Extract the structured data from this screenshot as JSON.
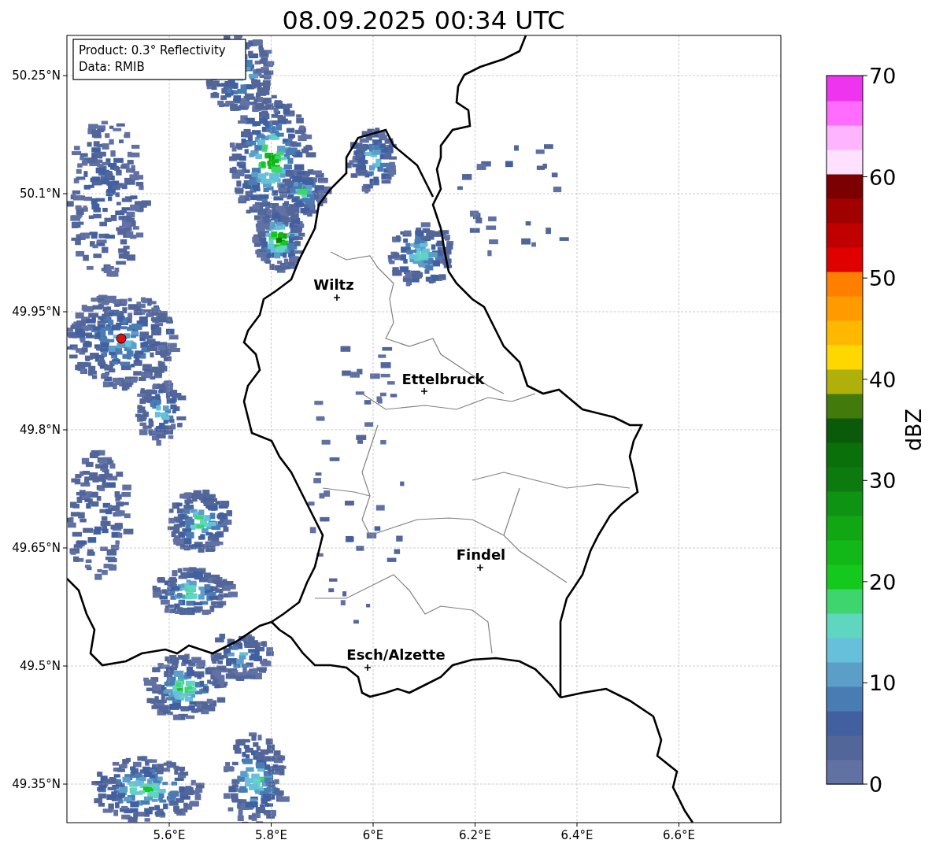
{
  "title": "08.09.2025 00:34 UTC",
  "info_box": {
    "lines": [
      "Product: 0.3° Reflectivity",
      "Data: RMIB"
    ]
  },
  "map": {
    "lat_ticks": [
      "50.25°N",
      "50.1°N",
      "49.95°N",
      "49.8°N",
      "49.65°N",
      "49.5°N",
      "49.35°N"
    ],
    "lon_ticks": [
      "5.6°E",
      "5.8°E",
      "6°E",
      "6.2°E",
      "6.4°E",
      "6.6°E"
    ],
    "cities": [
      {
        "name": "Wiltz"
      },
      {
        "name": "Ettelbruck"
      },
      {
        "name": "Findel"
      },
      {
        "name": "Esch/Alzette"
      }
    ]
  },
  "colorbar": {
    "label": "dBZ",
    "ticks": [
      "70",
      "60",
      "50",
      "40",
      "30",
      "20",
      "10",
      "0"
    ],
    "bands": [
      {
        "color": "#6171a3"
      },
      {
        "color": "#52669a"
      },
      {
        "color": "#4260a0"
      },
      {
        "color": "#4a7cb4"
      },
      {
        "color": "#5b9ec8"
      },
      {
        "color": "#66c0dc"
      },
      {
        "color": "#5fd6c0"
      },
      {
        "color": "#3ed46e"
      },
      {
        "color": "#14c81e"
      },
      {
        "color": "#12b818"
      },
      {
        "color": "#10a614"
      },
      {
        "color": "#0e9412"
      },
      {
        "color": "#0c7a0e"
      },
      {
        "color": "#0a700a"
      },
      {
        "color": "#0a5a0a"
      },
      {
        "color": "#437a0c"
      },
      {
        "color": "#b0b00a"
      },
      {
        "color": "#ffd700"
      },
      {
        "color": "#ffb800"
      },
      {
        "color": "#ff9a00"
      },
      {
        "color": "#ff8000"
      },
      {
        "color": "#e00000"
      },
      {
        "color": "#c00000"
      },
      {
        "color": "#a00000"
      },
      {
        "color": "#7c0000"
      },
      {
        "color": "#ffe0ff"
      },
      {
        "color": "#ffb4ff"
      },
      {
        "color": "#ff6cff"
      },
      {
        "color": "#ee34ee"
      }
    ]
  }
}
